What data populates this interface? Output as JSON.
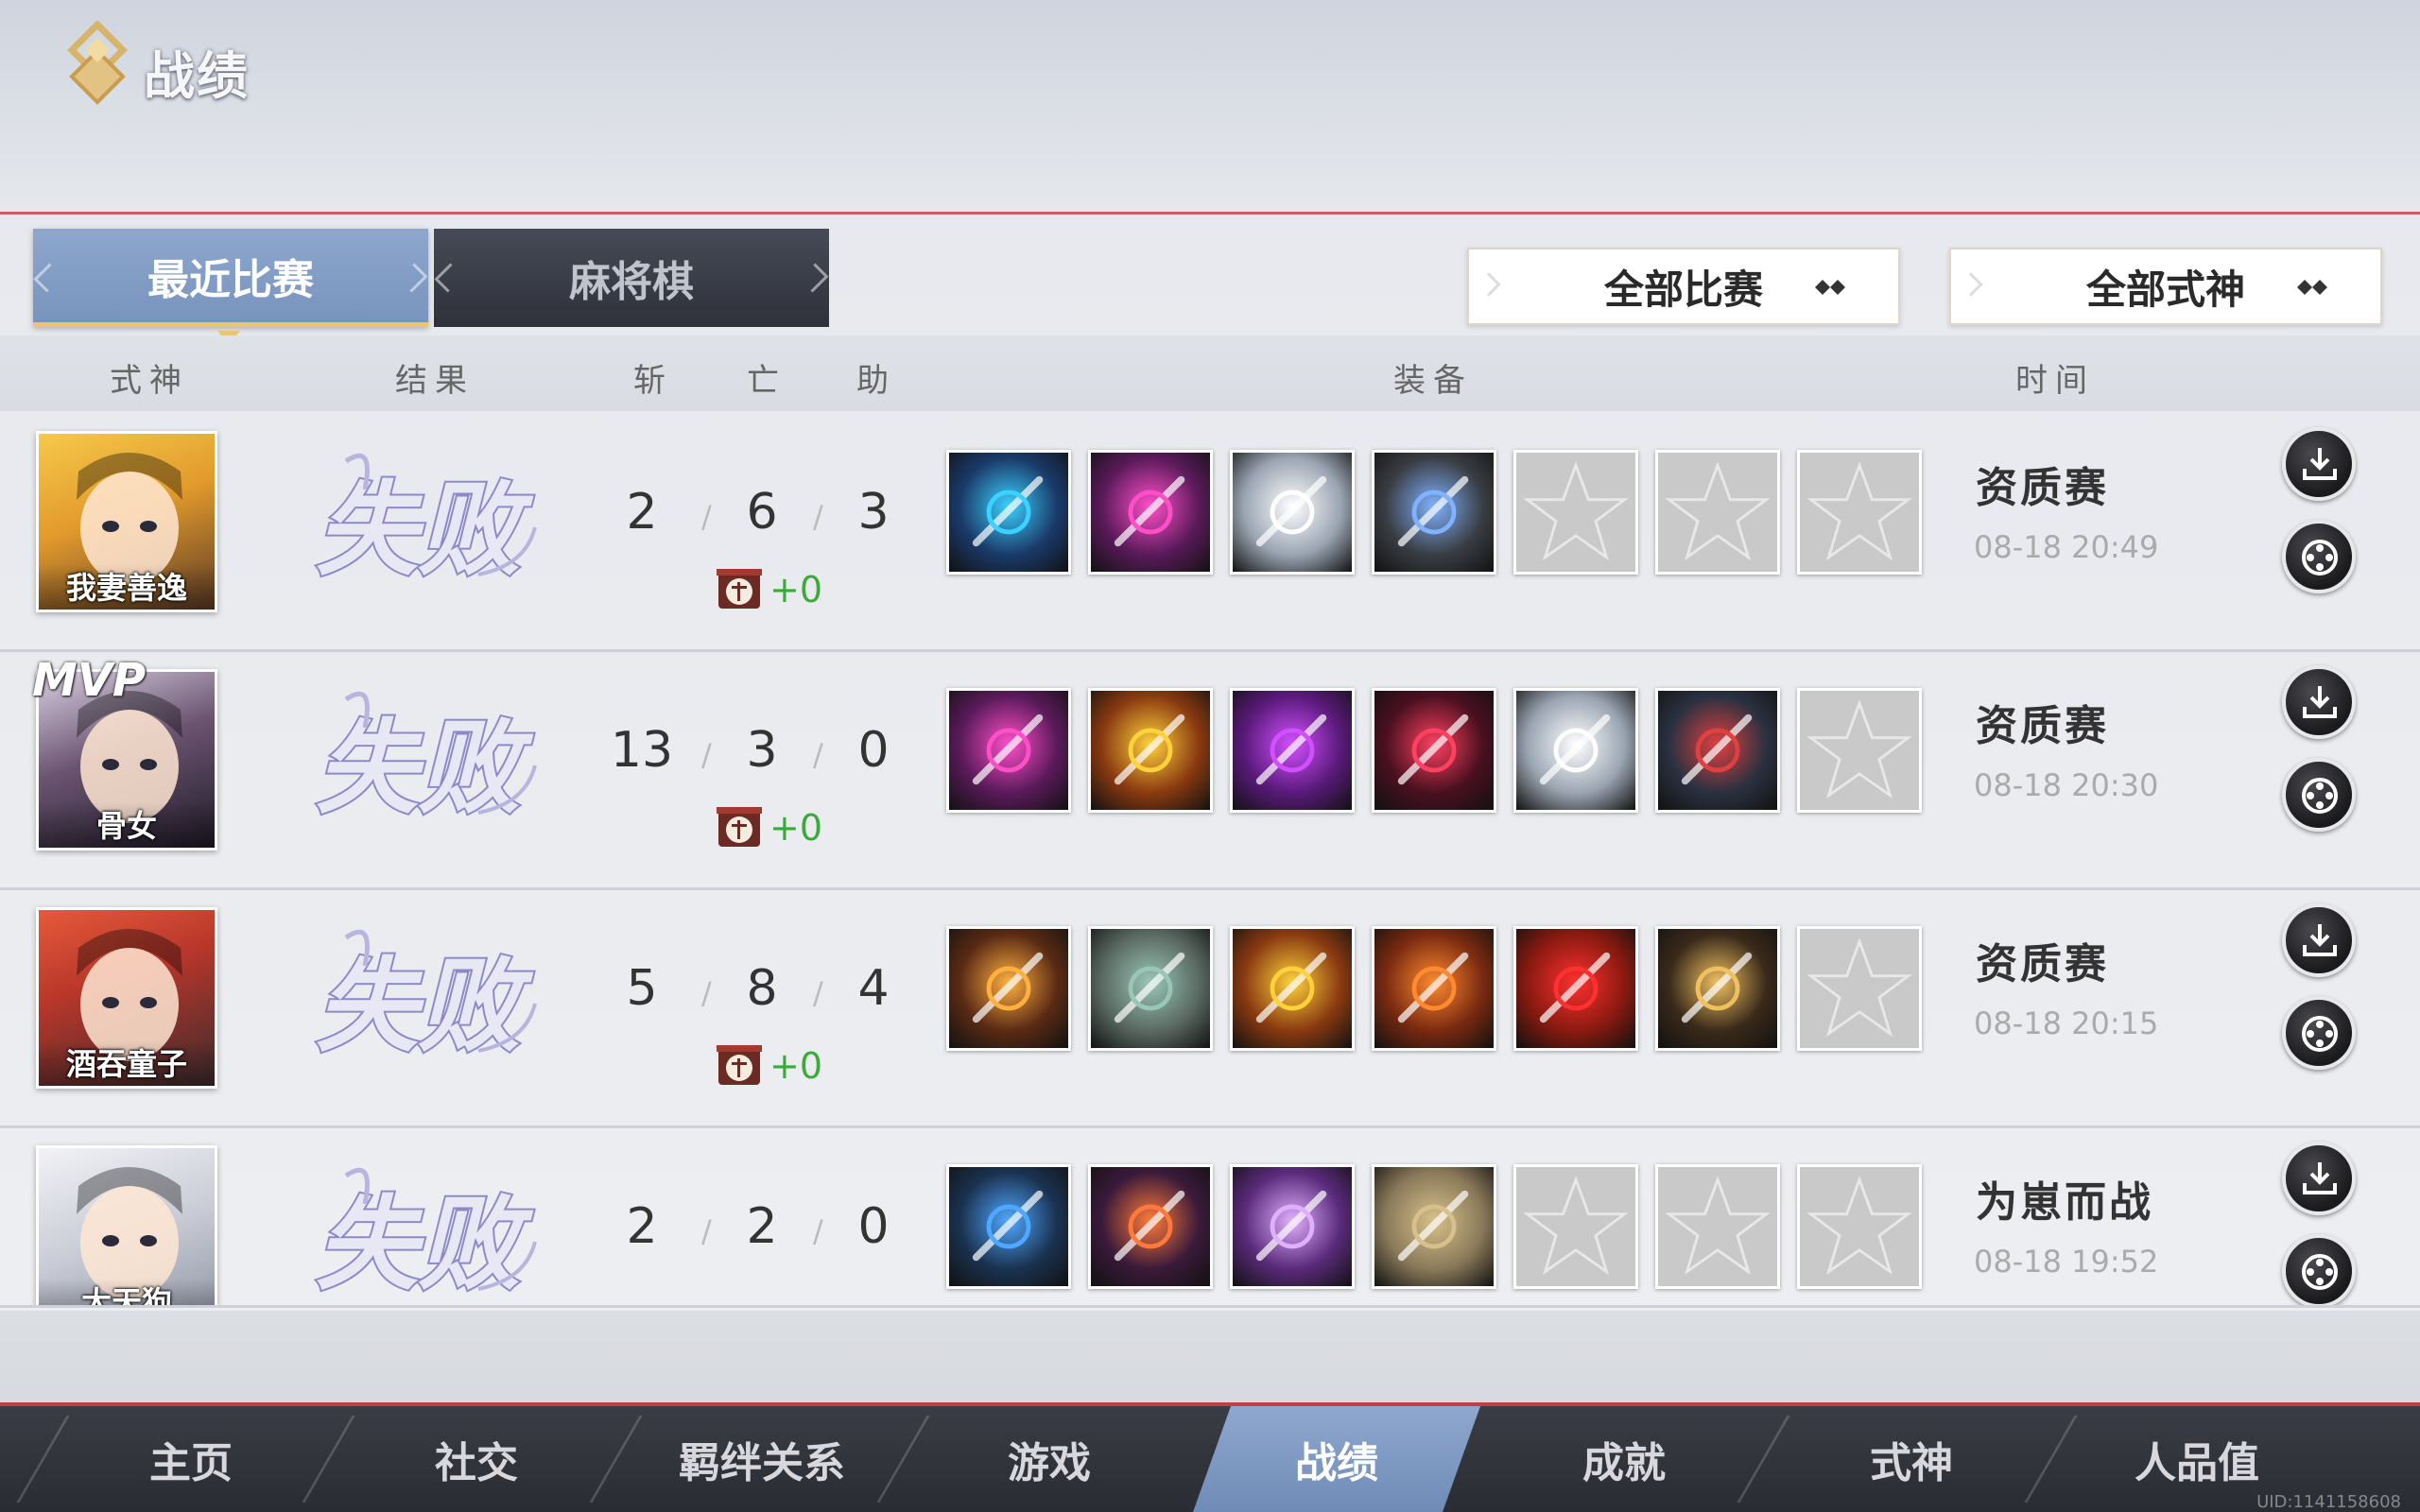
{
  "header": {
    "title": "战绩"
  },
  "tabs": [
    {
      "label": "最近比赛",
      "active": true
    },
    {
      "label": "麻将棋",
      "active": false
    }
  ],
  "filters": {
    "match_filter": "全部比赛",
    "shikigami_filter": "全部式神"
  },
  "columns": {
    "shikigami": "式神",
    "result": "结果",
    "kills": "斩",
    "deaths": "亡",
    "assists": "助",
    "equipment": "装备",
    "time": "时间"
  },
  "matches": [
    {
      "name": "我妻善逸",
      "mvp": "",
      "result": "失败",
      "kills": "2",
      "deaths": "6",
      "assists": "3",
      "bonus": "+0",
      "mode": "资质赛",
      "time": "08-18 20:49"
    },
    {
      "name": "骨女",
      "mvp": "MVP",
      "result": "失败",
      "kills": "13",
      "deaths": "3",
      "assists": "0",
      "bonus": "+0",
      "mode": "资质赛",
      "time": "08-18 20:30"
    },
    {
      "name": "酒吞童子",
      "mvp": "",
      "result": "失败",
      "kills": "5",
      "deaths": "8",
      "assists": "4",
      "bonus": "+0",
      "mode": "资质赛",
      "time": "08-18 20:15"
    },
    {
      "name": "大天狗",
      "mvp": "",
      "result": "失败",
      "kills": "2",
      "deaths": "2",
      "assists": "0",
      "bonus": "",
      "mode": "为崽而战",
      "time": "08-18 19:52"
    }
  ],
  "nav": [
    {
      "label": "主页",
      "active": false
    },
    {
      "label": "社交",
      "active": false
    },
    {
      "label": "羁绊关系",
      "active": false
    },
    {
      "label": "游戏",
      "active": false
    },
    {
      "label": "战绩",
      "active": true
    },
    {
      "label": "成就",
      "active": false
    },
    {
      "label": "式神",
      "active": false
    },
    {
      "label": "人品值",
      "active": false
    }
  ],
  "uid": "UID:1141158608",
  "colors": {
    "accent_blue": "#7f9bc5",
    "gold": "#e8c770",
    "red_line": "#c04040",
    "bonus_green": "#3aaa3a",
    "defeat_purple": "#8d89c9"
  },
  "icons": {
    "download": "download-icon",
    "replay": "film-reel-icon",
    "empty_slot": "star-icon"
  }
}
